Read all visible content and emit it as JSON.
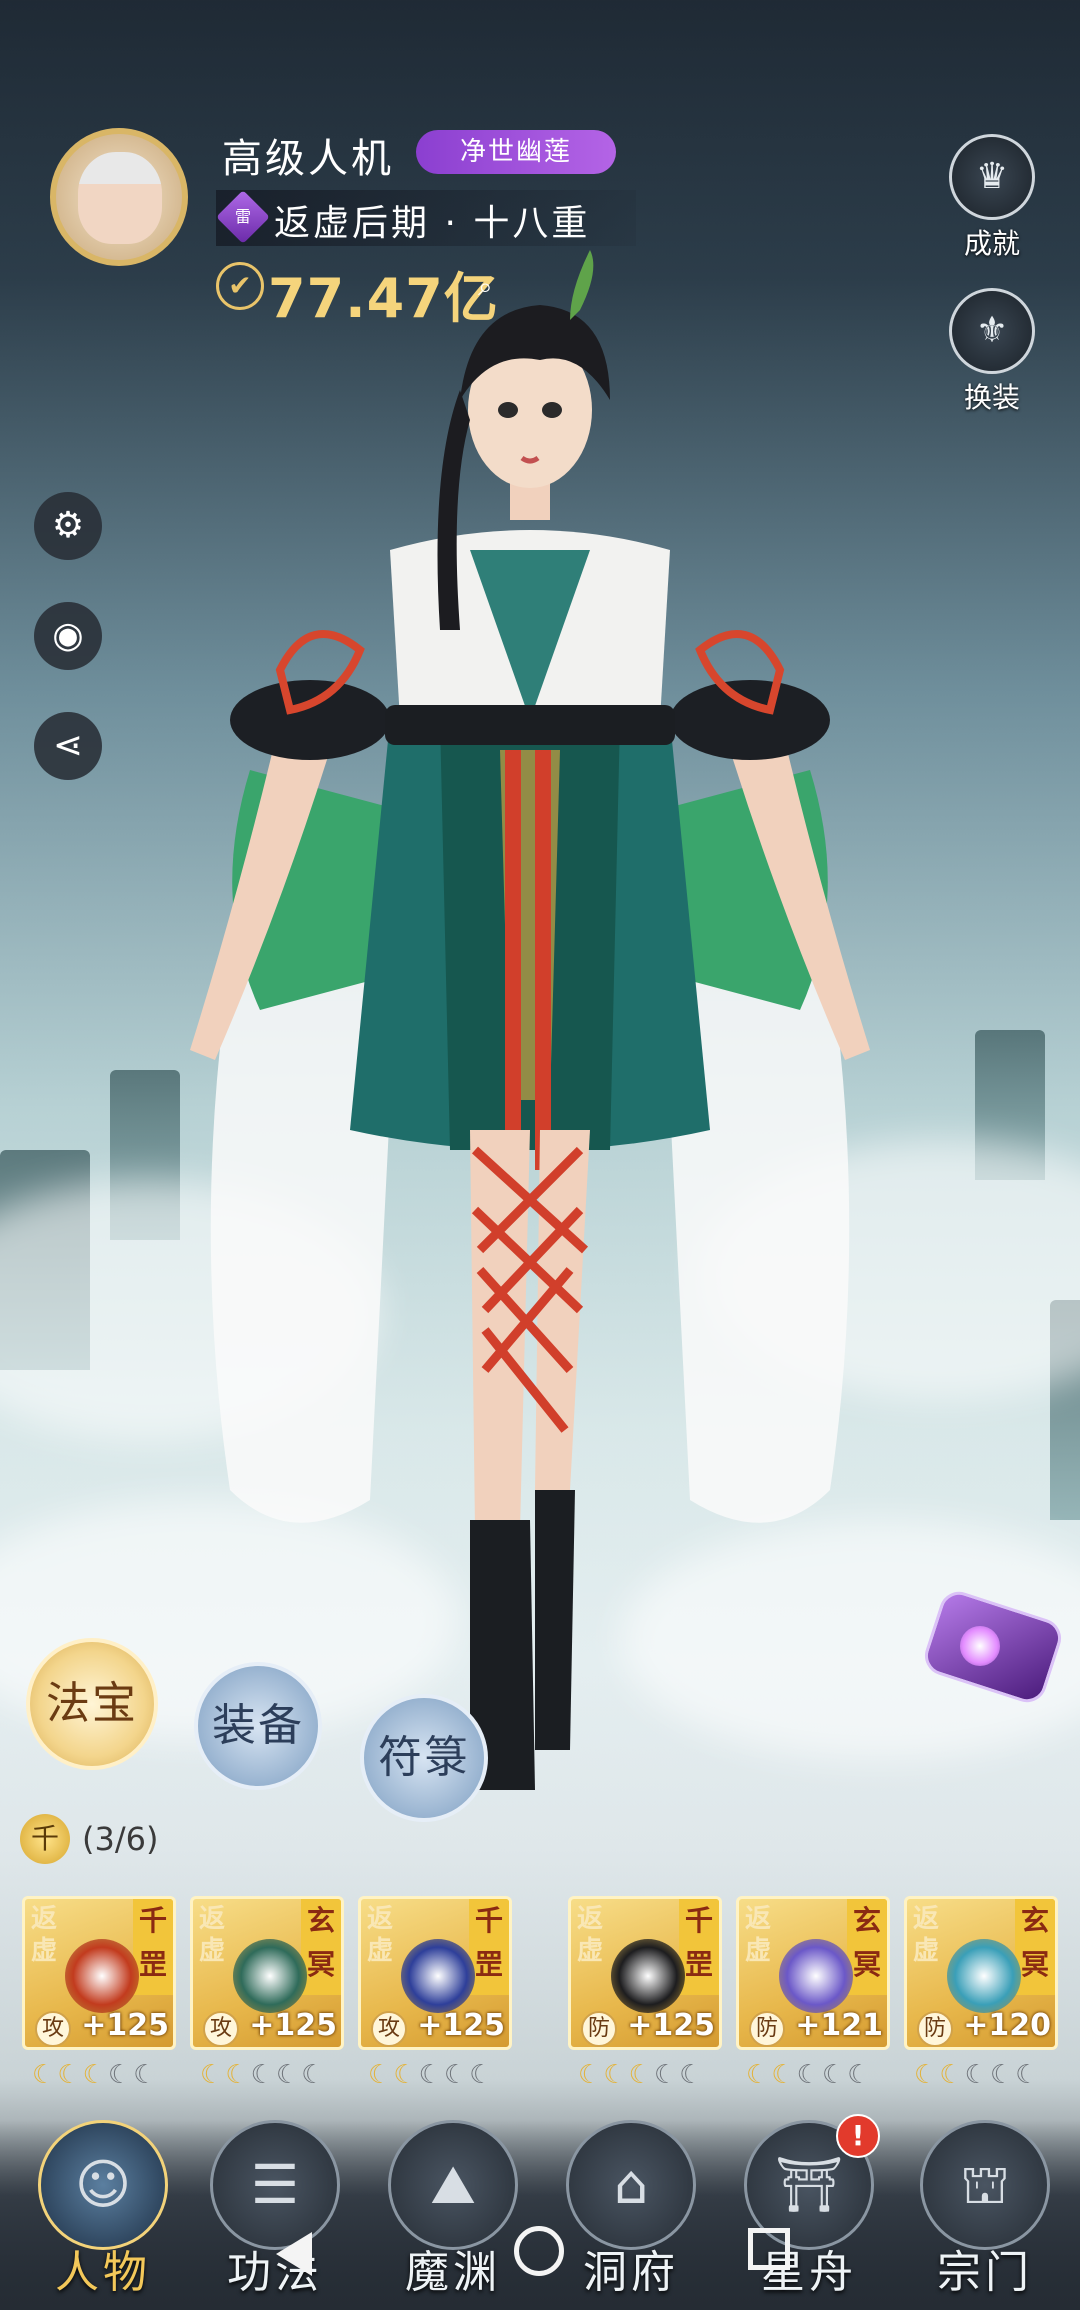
{
  "profile": {
    "name": "高级人机",
    "title_badge": "净世幽莲",
    "realm_gem": "雷",
    "realm": "返虚后期 · 十八重",
    "power": "77.47亿"
  },
  "right_menu": {
    "achievement_label": "成就",
    "outfit_label": "换装"
  },
  "tabs": {
    "treasure": "法宝",
    "equipment": "装备",
    "talisman": "符箓",
    "active": "法宝"
  },
  "set_bonus": {
    "coin": "千",
    "progress": "(3/6)"
  },
  "cards": [
    {
      "realm": "返虚",
      "type": "千罡",
      "kind": "攻",
      "level": "+125",
      "stars_lit": 3,
      "stars_total": 5,
      "color": "#c23b1e"
    },
    {
      "realm": "返虚",
      "type": "玄冥",
      "kind": "攻",
      "level": "+125",
      "stars_lit": 2,
      "stars_total": 5,
      "color": "#2f6b5a"
    },
    {
      "realm": "返虚",
      "type": "千罡",
      "kind": "攻",
      "level": "+125",
      "stars_lit": 2,
      "stars_total": 5,
      "color": "#2e3f9a"
    },
    {
      "realm": "返虚",
      "type": "千罡",
      "kind": "防",
      "level": "+125",
      "stars_lit": 3,
      "stars_total": 5,
      "color": "#1d1d1f"
    },
    {
      "realm": "返虚",
      "type": "玄冥",
      "kind": "防",
      "level": "+121",
      "stars_lit": 2,
      "stars_total": 5,
      "color": "#6b58c8"
    },
    {
      "realm": "返虚",
      "type": "玄冥",
      "kind": "防",
      "level": "+120",
      "stars_lit": 2,
      "stars_total": 5,
      "color": "#3a9fb8"
    }
  ],
  "nav": [
    {
      "label": "人物",
      "icon": "character-icon",
      "active": true
    },
    {
      "label": "功法",
      "icon": "technique-icon",
      "active": false
    },
    {
      "label": "魔渊",
      "icon": "abyss-icon",
      "active": false
    },
    {
      "label": "洞府",
      "icon": "cave-icon",
      "active": false
    },
    {
      "label": "星舟",
      "icon": "starship-icon",
      "active": false,
      "notification": "!"
    },
    {
      "label": "宗门",
      "icon": "sect-icon",
      "active": false
    }
  ]
}
